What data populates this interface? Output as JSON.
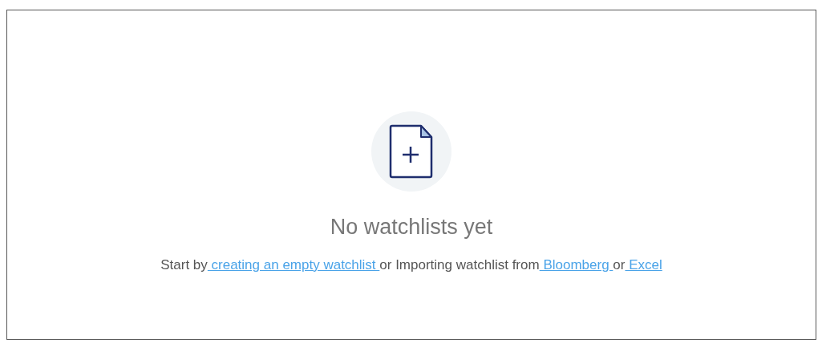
{
  "empty_state": {
    "title": "No watchlists yet",
    "message": [
      {
        "kind": "text",
        "text": "Start by"
      },
      {
        "kind": "link",
        "text": " creating an empty watchlist "
      },
      {
        "kind": "text",
        "text": "or Importing watchlist from"
      },
      {
        "kind": "link",
        "text": " Bloomberg "
      },
      {
        "kind": "text",
        "text": "or"
      },
      {
        "kind": "link",
        "text": " Excel"
      }
    ]
  }
}
